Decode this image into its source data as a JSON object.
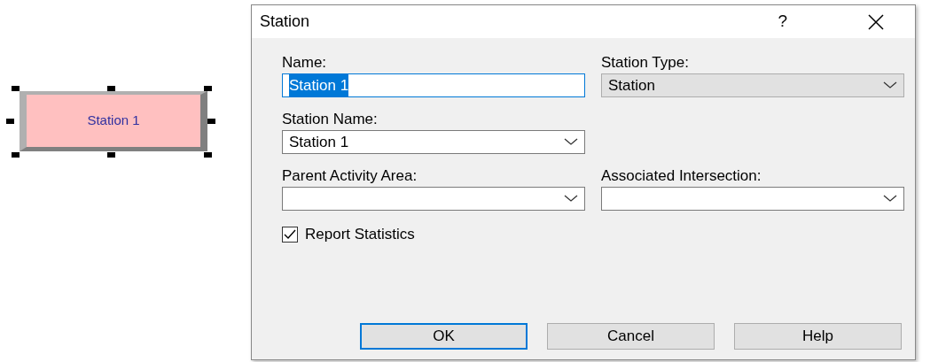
{
  "canvas": {
    "node": {
      "label": "Station 1",
      "selected": true
    }
  },
  "dialog": {
    "title": "Station",
    "help": "?",
    "fields": [
      {
        "kind": "text",
        "label": "Name:",
        "value": "Station 1",
        "text_selected": true,
        "focused": true
      },
      {
        "kind": "list",
        "label": "Station Type:",
        "value": "Station"
      },
      {
        "kind": "combo",
        "label": "Station Name:",
        "value": "Station 1"
      },
      {
        "kind": "blank"
      },
      {
        "kind": "combo",
        "label": "Parent Activity Area:"
      },
      {
        "kind": "combo",
        "label": "Associated Intersection:"
      }
    ],
    "checkbox": {
      "label": "Report Statistics",
      "checked": true
    },
    "buttons": [
      {
        "label": "OK",
        "default": true
      },
      {
        "label": "Cancel",
        "default": false
      },
      {
        "label": "Help",
        "default": false
      }
    ]
  }
}
